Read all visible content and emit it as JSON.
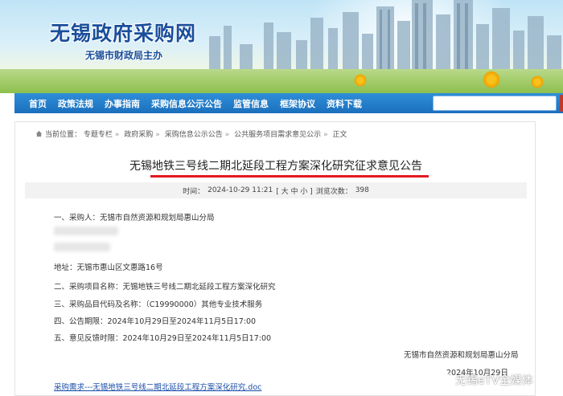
{
  "header": {
    "site_title": "无锡政府采购网",
    "site_subtitle": "无锡市财政局主办"
  },
  "nav": {
    "items": [
      {
        "label": "首页"
      },
      {
        "label": "政策法规"
      },
      {
        "label": "办事指南"
      },
      {
        "label": "采购信息公示公告"
      },
      {
        "label": "监管信息"
      },
      {
        "label": "框架协议"
      },
      {
        "label": "资料下载"
      }
    ],
    "search_value": ""
  },
  "breadcrumb": {
    "prefix": "当前位置：",
    "items": [
      "专题专栏",
      "政府采购",
      "采购信息公示公告",
      "公共服务项目需求意见公示",
      "正文"
    ],
    "separator": "»"
  },
  "article": {
    "title": "无锡地铁三号线二期北延段工程方案深化研究征求意见公告",
    "meta": {
      "time_label": "时间：",
      "time_value": "2024-10-29 11:21",
      "size_control": "[ 大 中 小 ]",
      "views_label": "浏览次数：",
      "views_value": "398"
    },
    "lines": {
      "purchaser": "一、采购人：无锡市自然资源和规划局惠山分局",
      "address": "地址：无锡市惠山区文惠路16号",
      "project_name": "二、采购项目名称：无锡地铁三号线二期北延段工程方案深化研究",
      "item_code": "三、采购品目代码及名称：（C19990000）其他专业技术服务",
      "notice_period": "四、公告期限：2024年10月29日至2024年11月5日17:00",
      "feedback_period": "五、意见反馈时限：2024年10月29日至2024年11月5日17:00"
    },
    "signature": {
      "org": "无锡市自然资源和规划局惠山分局",
      "date": "2024年10月29日"
    },
    "attachment": "采购需求---无锡地铁三号线二期北延段工程方案深化研究.doc"
  },
  "watermark": {
    "text": "无锡eTV全媒体"
  },
  "colors": {
    "nav_blue": "#1b6fbd",
    "title_blue": "#1a4e9a",
    "underline_red": "#e0181f",
    "link_blue": "#1a4ea8",
    "search_red": "#c0392b"
  }
}
